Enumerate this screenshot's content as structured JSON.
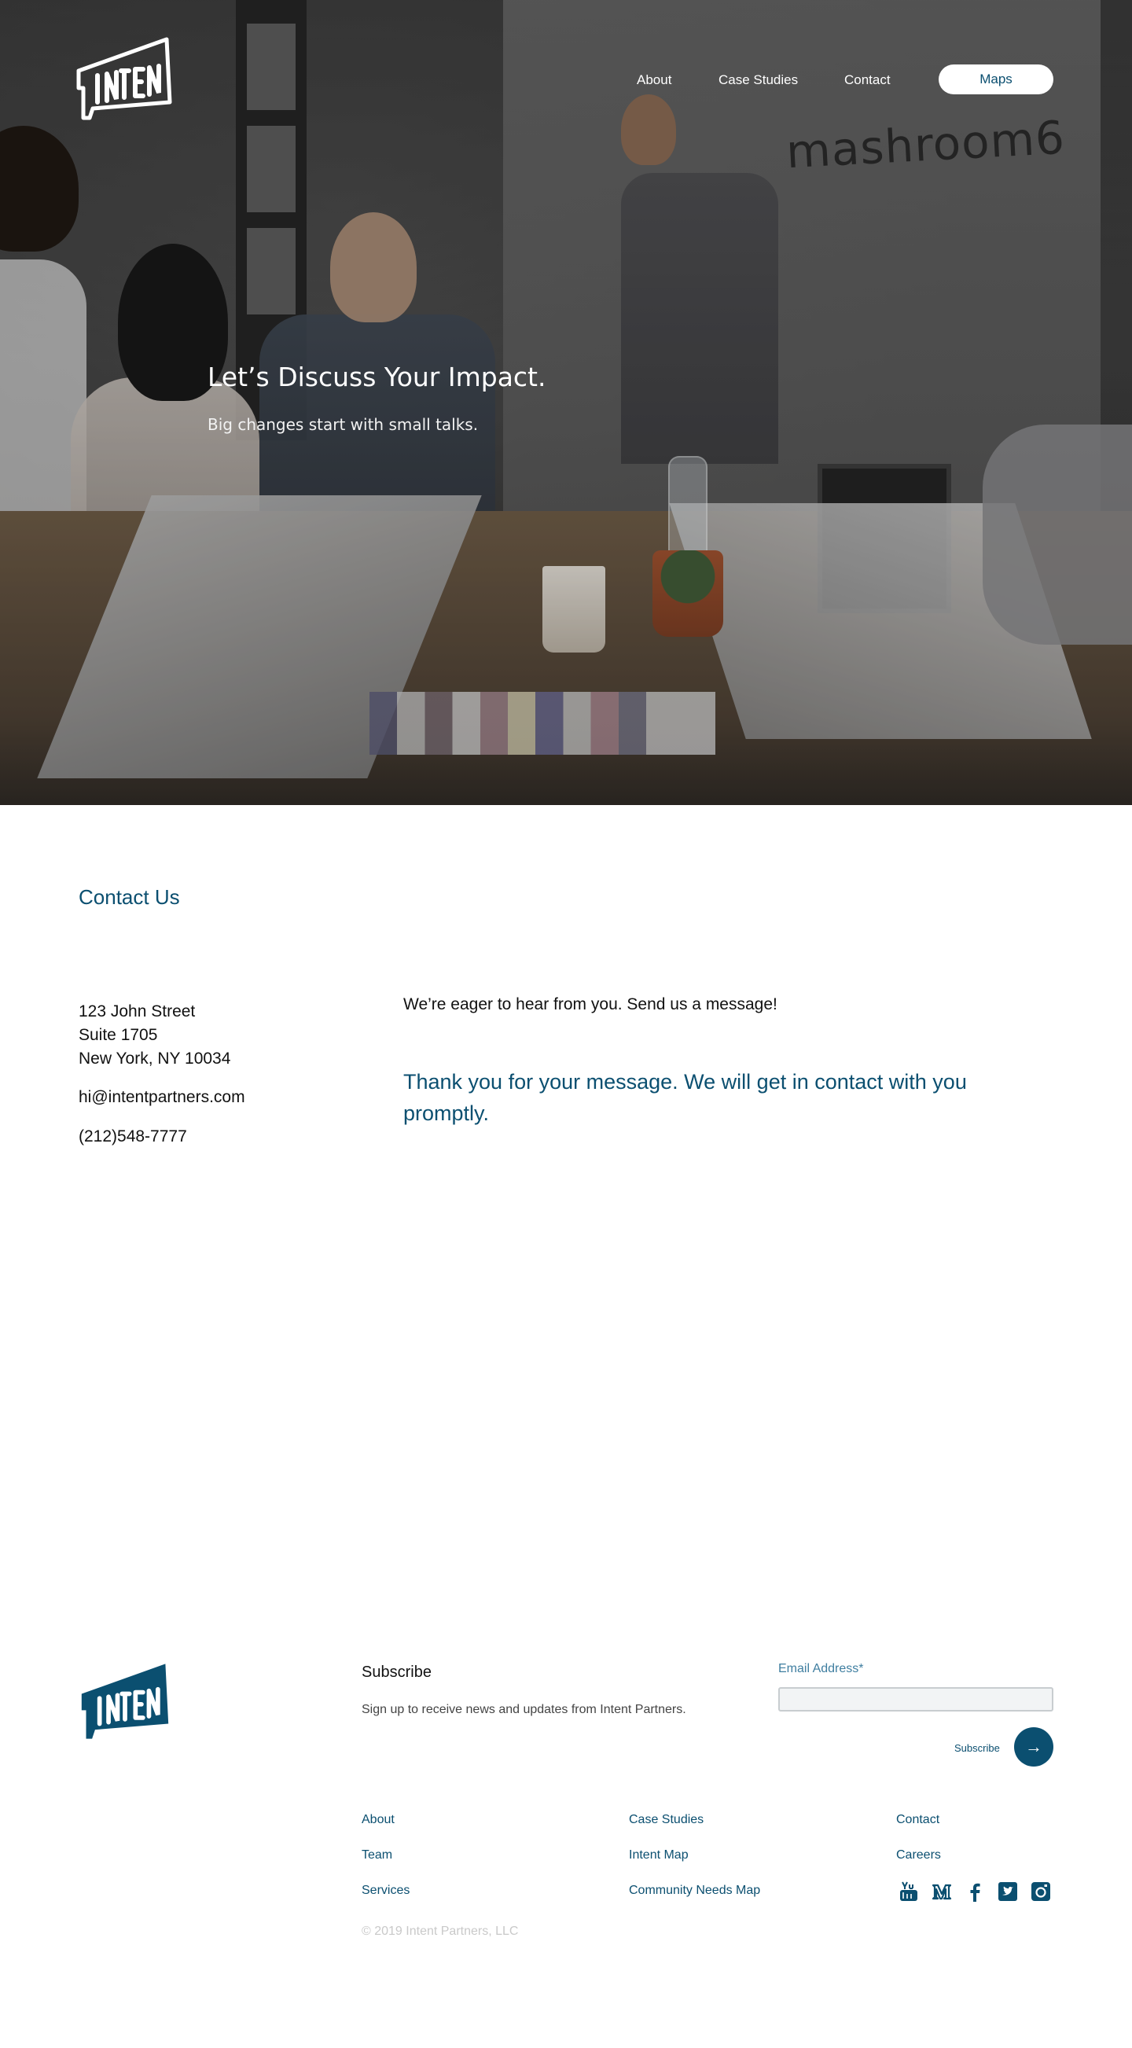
{
  "colors": {
    "brand": "#0b4f70",
    "white": "#ffffff",
    "muted": "#c9c9c9"
  },
  "header": {
    "logo_alt": "Intent",
    "nav": {
      "about": "About",
      "case_studies": "Case Studies",
      "contact": "Contact",
      "maps": "Maps"
    }
  },
  "hero": {
    "wall_sign": "mashroom6",
    "title": "Let’s Discuss Your Impact.",
    "subtitle": "Big changes start with small talks."
  },
  "contact": {
    "heading": "Contact Us",
    "address_line1": "123 John Street",
    "address_line2": "Suite 1705",
    "address_line3": "New York, NY 10034",
    "email": "hi@intentpartners.com",
    "phone": "(212)548-7777",
    "intro": "We’re eager to hear from you. Send us a message!",
    "thanks": "Thank you for your message. We will get in contact with you promptly."
  },
  "footer": {
    "subscribe_title": "Subscribe",
    "subscribe_text": "Sign up to receive news and updates from Intent Partners.",
    "email_label": "Email Address*",
    "email_value": "",
    "subscribe_button": "Subscribe",
    "links": {
      "about": "About",
      "team": "Team",
      "services": "Services",
      "case_studies": "Case Studies",
      "intent_map": "Intent Map",
      "community_needs_map": "Community Needs Map",
      "contact": "Contact",
      "careers": "Careers"
    },
    "social_icons": [
      "youtube-icon",
      "medium-icon",
      "facebook-icon",
      "twitter-icon",
      "instagram-icon"
    ],
    "copyright": "© 2019 Intent Partners, LLC"
  }
}
